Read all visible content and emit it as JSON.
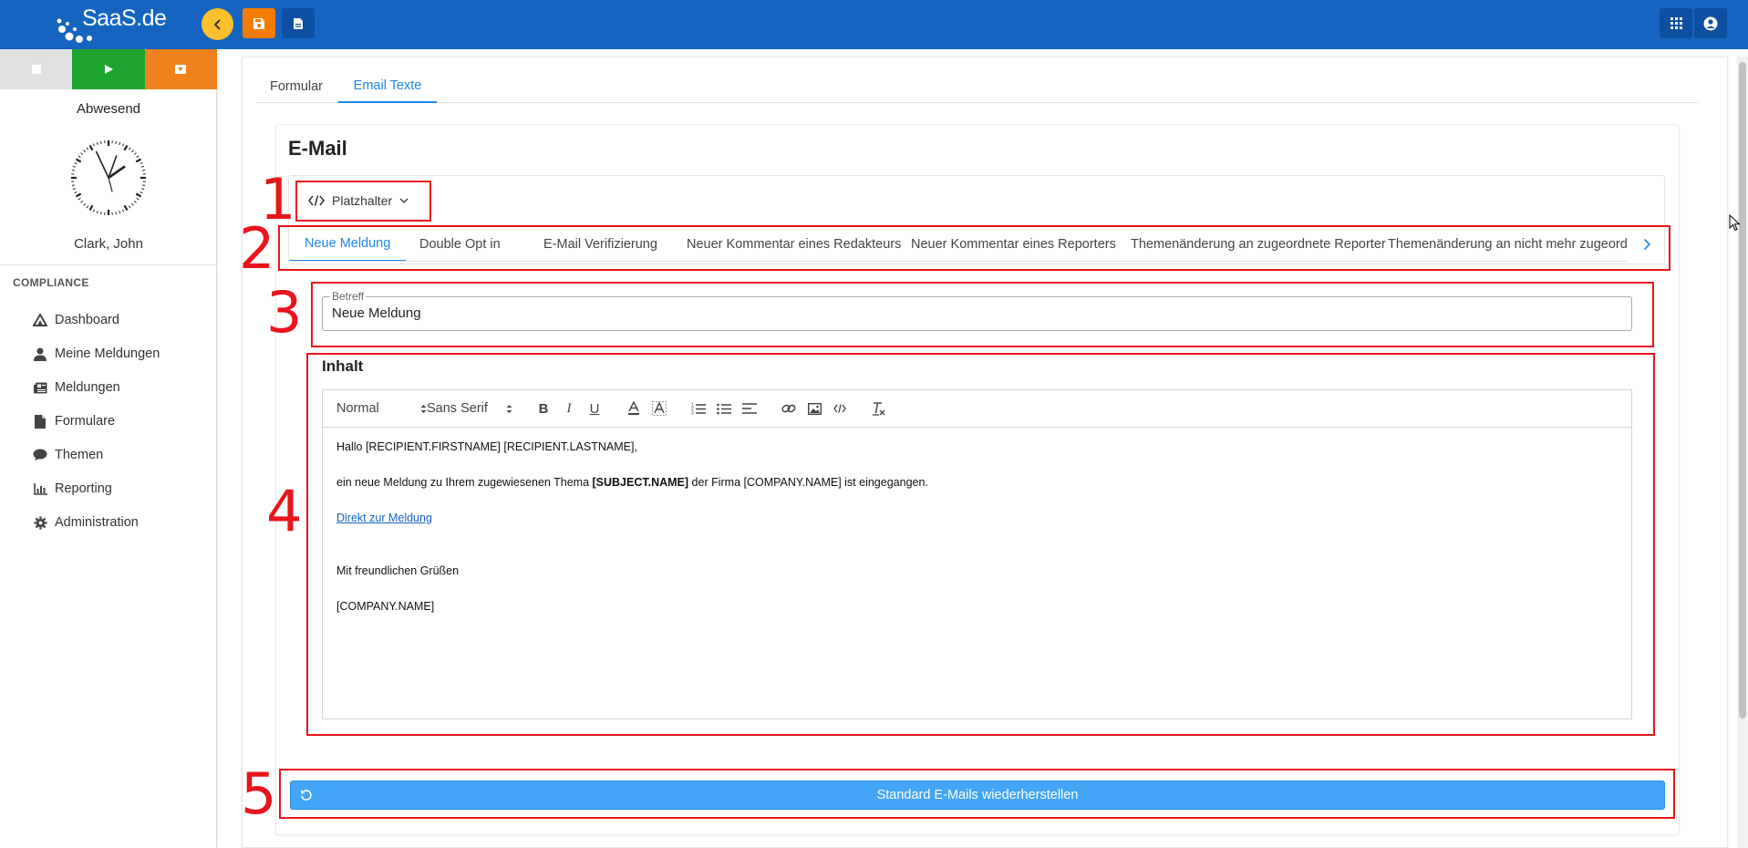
{
  "header": {
    "logo_text": "SaaS.de",
    "back_icon": "chevron-left-icon",
    "save_icon": "floppy-disk-icon",
    "document_icon": "document-icon",
    "apps_icon": "grid-icon",
    "user_icon": "user-circle-icon",
    "colors": {
      "bar": "#1565c0",
      "back": "#fbc02d",
      "save": "#f57c00"
    }
  },
  "sidebar": {
    "status_buttons": [
      {
        "icon": "stop-icon",
        "color": "#e0e0e0"
      },
      {
        "icon": "play-icon",
        "color": "#1ea52f"
      },
      {
        "icon": "pause-icon",
        "color": "#f0821e"
      }
    ],
    "status_label": "Abwesend",
    "clock_icon": "analog-clock-icon",
    "user_name": "Clark, John",
    "section": "COMPLIANCE",
    "items": [
      {
        "label": "Dashboard",
        "icon": "dashboard-icon"
      },
      {
        "label": "Meine Meldungen",
        "icon": "person-icon"
      },
      {
        "label": "Meldungen",
        "icon": "newspaper-icon"
      },
      {
        "label": "Formulare",
        "icon": "file-icon"
      },
      {
        "label": "Themen",
        "icon": "comment-icon"
      },
      {
        "label": "Reporting",
        "icon": "bar-chart-icon"
      },
      {
        "label": "Administration",
        "icon": "gear-icon"
      }
    ]
  },
  "main": {
    "tabs": [
      {
        "label": "Formular"
      },
      {
        "label": "Email Texte",
        "active": true
      }
    ],
    "card_title": "E-Mail",
    "placeholder_button": "Platzhalter",
    "mail_tabs": [
      "Neue Meldung",
      "Double Opt in",
      "E-Mail Verifizierung",
      "Neuer Kommentar eines Redakteurs",
      "Neuer Kommentar eines Reporters",
      "Themenänderung an zugeordnete Reporter",
      "Themenänderung an nicht mehr zugeordnete Reporter"
    ],
    "subject": {
      "label": "Betreff",
      "value": "Neue Meldung"
    },
    "content": {
      "title": "Inhalt",
      "toolbar": {
        "size": "Normal",
        "font": "Sans Serif"
      },
      "lines": {
        "greeting": "Hallo [RECIPIENT.FIRSTNAME] [RECIPIENT.LASTNAME],",
        "body_prefix": "ein neue Meldung zu Ihrem zugewiesenen Thema ",
        "body_bold": "[SUBJECT.NAME]",
        "body_suffix": " der Firma [COMPANY.NAME] ist eingegangen.",
        "link": "Direkt zur Meldung",
        "closing": "Mit freundlichen Grüßen",
        "company": "[COMPANY.NAME]"
      }
    },
    "restore_button": "Standard E-Mails wiederherstellen"
  },
  "annotations": [
    "1",
    "2",
    "3",
    "4",
    "5"
  ]
}
